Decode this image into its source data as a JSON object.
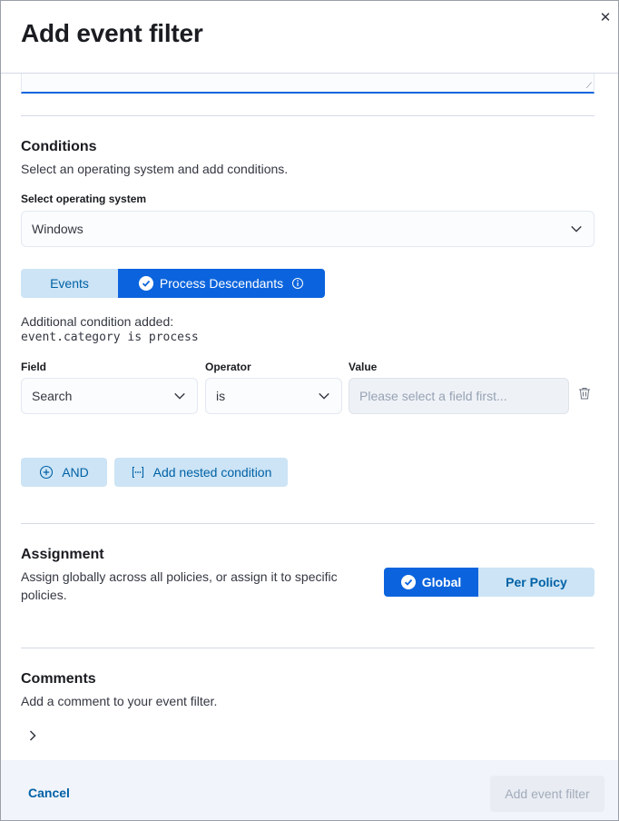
{
  "header": {
    "title": "Add event filter",
    "close_icon": "close-icon"
  },
  "conditions": {
    "title": "Conditions",
    "description": "Select an operating system and add conditions.",
    "os_label": "Select operating system",
    "os_value": "Windows",
    "tabs": [
      {
        "label": "Events",
        "selected": false
      },
      {
        "label": "Process Descendants",
        "selected": true
      }
    ],
    "added_label": "Additional condition added:",
    "added_code": "event.category is process",
    "field_label": "Field",
    "operator_label": "Operator",
    "value_label": "Value",
    "field_value": "Search",
    "operator_value": "is",
    "value_placeholder": "Please select a field first...",
    "and_label": "AND",
    "nested_label": "Add nested condition"
  },
  "assignment": {
    "title": "Assignment",
    "description": "Assign globally across all policies, or assign it to specific policies.",
    "options": [
      {
        "label": "Global",
        "selected": true
      },
      {
        "label": "Per Policy",
        "selected": false
      }
    ]
  },
  "comments": {
    "title": "Comments",
    "description": "Add a comment to your event filter."
  },
  "footer": {
    "cancel_label": "Cancel",
    "submit_label": "Add event filter"
  },
  "colors": {
    "primary": "#0b64dd",
    "primary_light": "#cce4f5",
    "link": "#0061a6"
  }
}
